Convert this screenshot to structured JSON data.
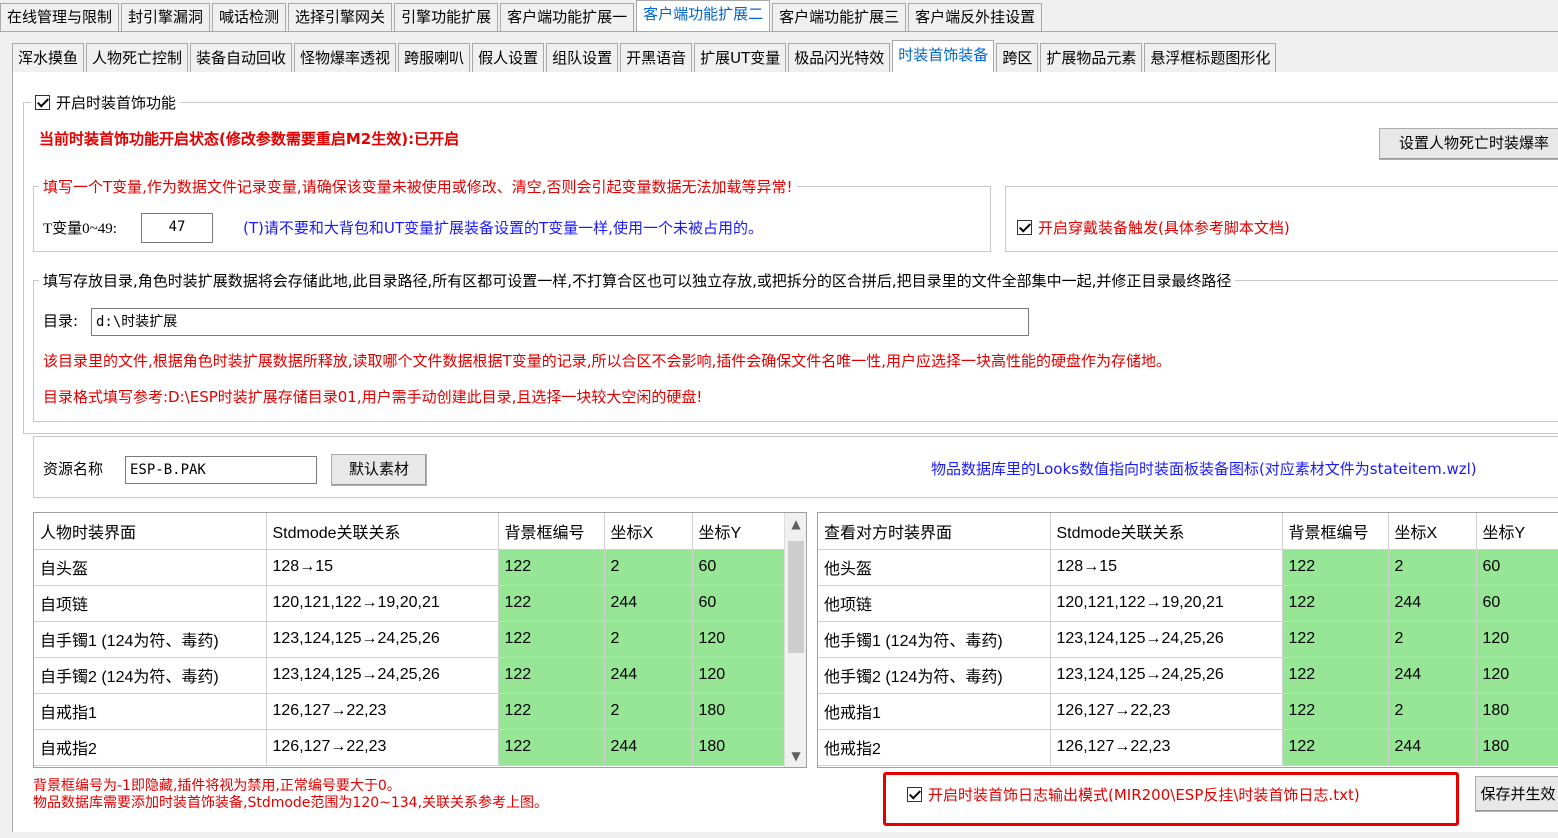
{
  "top_tabs": [
    "在线管理与限制",
    "封引擎漏洞",
    "喊话检测",
    "选择引擎网关",
    "引擎功能扩展",
    "客户端功能扩展一",
    "客户端功能扩展二",
    "客户端功能扩展三",
    "客户端反外挂设置"
  ],
  "top_active": 6,
  "sub_tabs": [
    "浑水摸鱼",
    "人物死亡控制",
    "装备自动回收",
    "怪物爆率透视",
    "跨服喇叭",
    "假人设置",
    "组队设置",
    "开黑语音",
    "扩展UT变量",
    "极品闪光特效",
    "时装首饰装备",
    "跨区",
    "扩展物品元素",
    "悬浮框标题图形化"
  ],
  "sub_active": 10,
  "main": {
    "enable_label": "开启时装首饰功能",
    "status_text": "当前时装首饰功能开启状态(修改参数需要重启M2生效):已开启",
    "death_button": "设置人物死亡时装爆率",
    "tvar_legend": "填写一个T变量,作为数据文件记录变量,请确保该变量未被使用或修改、清空,否则会引起变量数据无法加载等异常!",
    "tvar_label": "T变量0~49:",
    "tvar_value": "47",
    "tvar_hint": "(T)请不要和大背包和UT变量扩展装备设置的T变量一样,使用一个未被占用的。",
    "wear_trigger_label": "开启穿戴装备触发(具体参考脚本文档)",
    "dir_legend": "填写存放目录,角色时装扩展数据将会存储此地,此目录路径,所有区都可设置一样,不打算合区也可以独立存放,或把拆分的区合拼后,把目录里的文件全部集中一起,并修正目录最终路径",
    "dir_label": "目录:",
    "dir_value": "d:\\时装扩展",
    "dir_note1": "该目录里的文件,根据角色时装扩展数据所释放,读取哪个文件数据根据T变量的记录,所以合区不会影响,插件会确保文件名唯一性,用户应选择一块高性能的硬盘作为存储地。",
    "dir_note2": "目录格式填写参考:D:\\ESP时装扩展存储目录01,用户需手动创建此目录,且选择一块较大空闲的硬盘!",
    "res_label": "资源名称",
    "res_value": "ESP-B.PAK",
    "default_button": "默认素材",
    "res_hint": "物品数据库里的Looks数值指向时装面板装备图标(对应素材文件为stateitem.wzl)",
    "bottom_note1": "背景框编号为-1即隐藏,插件将视为禁用,正常编号要大于0。",
    "bottom_note2": "物品数据库需要添加时装首饰装备,Stdmode范围为120~134,关联关系参考上图。",
    "log_label": "开启时装首饰日志输出模式(MIR200\\ESP反挂\\时装首饰日志.txt)",
    "save_button": "保存并生效"
  },
  "left_table": {
    "headers": [
      "人物时装界面",
      "Stdmode关联关系",
      "背景框编号",
      "坐标X",
      "坐标Y"
    ],
    "rows": [
      [
        "自头盔",
        "128→15",
        "122",
        "2",
        "60"
      ],
      [
        "自项链",
        "120,121,122→19,20,21",
        "122",
        "244",
        "60"
      ],
      [
        "自手镯1 (124为符、毒药)",
        "123,124,125→24,25,26",
        "122",
        "2",
        "120"
      ],
      [
        "自手镯2 (124为符、毒药)",
        "123,124,125→24,25,26",
        "122",
        "244",
        "120"
      ],
      [
        "自戒指1",
        "126,127→22,23",
        "122",
        "2",
        "180"
      ],
      [
        "自戒指2",
        "126,127→22,23",
        "122",
        "244",
        "180"
      ]
    ]
  },
  "right_table": {
    "headers": [
      "查看对方时装界面",
      "Stdmode关联关系",
      "背景框编号",
      "坐标X",
      "坐标Y"
    ],
    "rows": [
      [
        "他头盔",
        "128→15",
        "122",
        "2",
        "60"
      ],
      [
        "他项链",
        "120,121,122→19,20,21",
        "122",
        "244",
        "60"
      ],
      [
        "他手镯1 (124为符、毒药)",
        "123,124,125→24,25,26",
        "122",
        "2",
        "120"
      ],
      [
        "他手镯2 (124为符、毒药)",
        "123,124,125→24,25,26",
        "122",
        "244",
        "120"
      ],
      [
        "他戒指1",
        "126,127→22,23",
        "122",
        "2",
        "180"
      ],
      [
        "他戒指2",
        "126,127→22,23",
        "122",
        "244",
        "180"
      ]
    ]
  },
  "colors": {
    "green_cell": "#96e696",
    "red_text": "#e00000",
    "blue_text": "#1a1aff",
    "highlight": "#e60000"
  }
}
